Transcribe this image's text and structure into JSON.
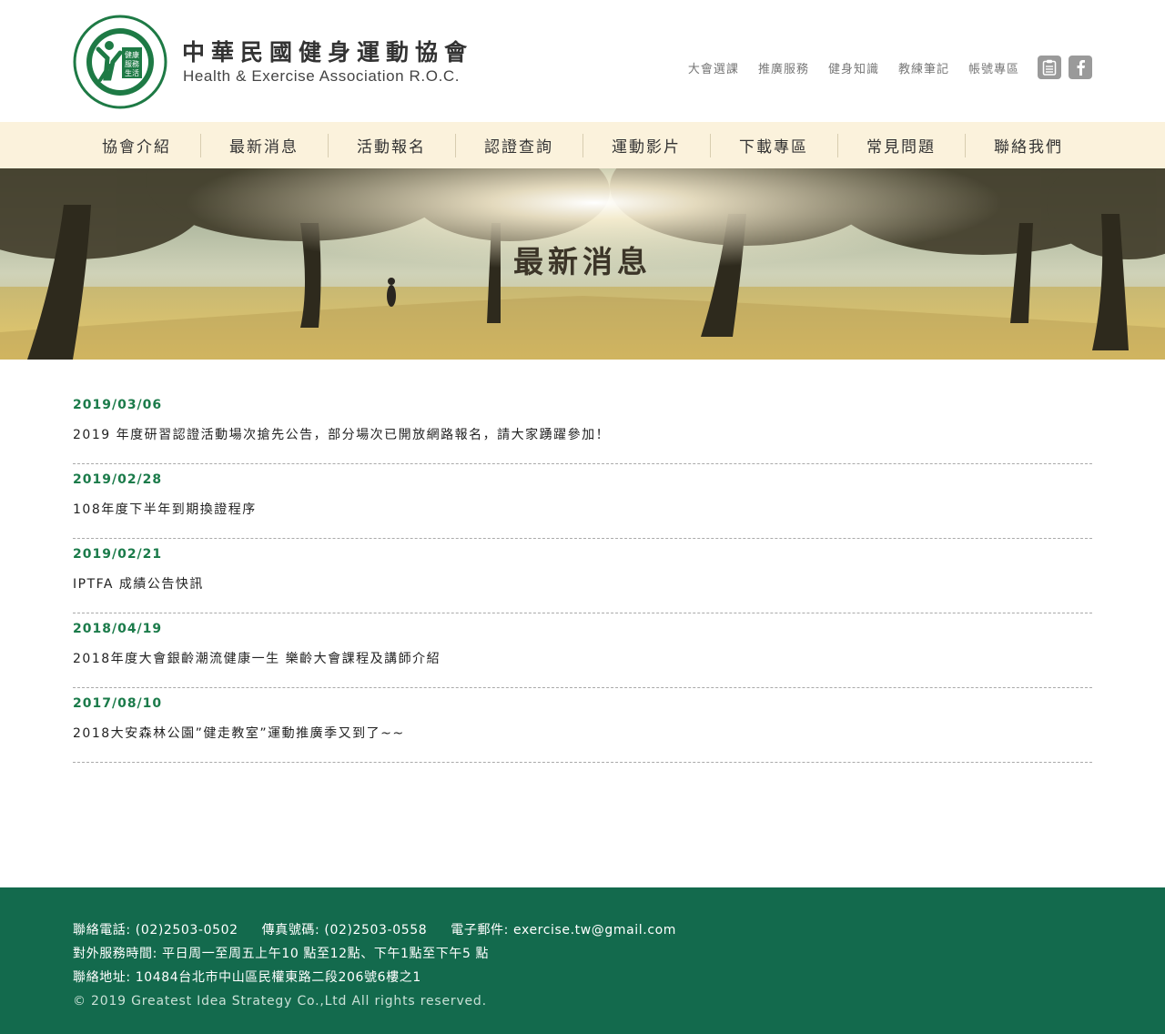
{
  "header": {
    "logo_cn": "中華民國健身運動協會",
    "logo_en": "Health & Exercise Association R.O.C.",
    "seal_text": "健康 服務 生活",
    "top_links": [
      "大會選課",
      "推廣服務",
      "健身知識",
      "教練筆記",
      "帳號專區"
    ],
    "icons": [
      "clipboard-icon",
      "facebook-icon"
    ]
  },
  "nav": [
    "協會介紹",
    "最新消息",
    "活動報名",
    "認證查詢",
    "運動影片",
    "下載專區",
    "常見問題",
    "聯絡我們"
  ],
  "banner": {
    "title": "最新消息"
  },
  "news": [
    {
      "date": "2019/03/06",
      "title": "2019 年度研習認證活動場次搶先公告，部分場次已開放網路報名，請大家踴躍參加！"
    },
    {
      "date": "2019/02/28",
      "title": "108年度下半年到期換證程序"
    },
    {
      "date": "2019/02/21",
      "title": "IPTFA 成績公告快訊"
    },
    {
      "date": "2018/04/19",
      "title": "2018年度大會銀齡潮流健康一生 樂齡大會課程及講師介紹"
    },
    {
      "date": "2017/08/10",
      "title": "2018大安森林公園”健走教室”運動推廣季又到了~~"
    }
  ],
  "footer": {
    "phone": "聯絡電話: (02)2503-0502",
    "fax": "傳真號碼: (02)2503-0558",
    "email": "電子郵件: exercise.tw@gmail.com",
    "hours": "對外服務時間: 平日周一至周五上午10 點至12點、下午1點至下午5 點",
    "address": "聯絡地址: 10484台北市中山區民權東路二段206號6樓之1",
    "copyright": "© 2019 Greatest Idea Strategy Co.,Ltd All rights reserved."
  },
  "colors": {
    "brand_green": "#136a4d",
    "date_green": "#1b7b4a",
    "nav_bg": "#fbf2dc"
  }
}
